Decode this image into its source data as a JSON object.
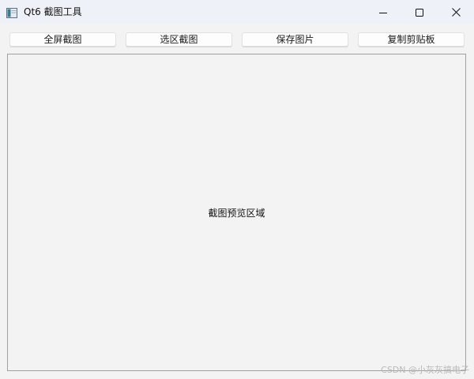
{
  "window": {
    "title": "Qt6 截图工具",
    "icon": "app-window-icon",
    "controls": {
      "minimize_icon": "minimize-icon",
      "maximize_icon": "maximize-icon",
      "close_icon": "close-icon"
    }
  },
  "toolbar": {
    "fullscreen_label": "全屏截图",
    "region_label": "选区截图",
    "save_label": "保存图片",
    "copy_label": "复制剪贴板"
  },
  "preview": {
    "placeholder": "截图预览区域"
  },
  "watermark": {
    "text": "CSDN @小灰灰搞电子"
  },
  "colors": {
    "titlebar_bg": "#eef2f8",
    "window_bg": "#f3f3f3",
    "preview_border": "#a0a0a0"
  }
}
